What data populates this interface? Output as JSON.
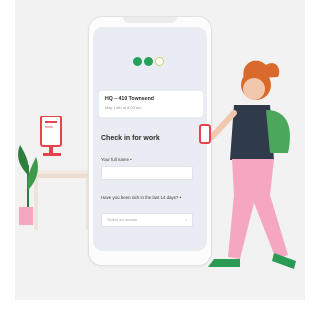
{
  "brand": {
    "accent_green": "#25a05a",
    "accent_lime": "#c9d46a",
    "ui_bg": "#e9edf3",
    "illustration_red": "#e8424c",
    "illustration_pink": "#f5a6c1"
  },
  "phone": {
    "progress": {
      "completed_steps": 2,
      "total_steps": 3
    },
    "location": {
      "title": "HQ – 410 Townsend",
      "subtitle": "May 14th at 8:00 am"
    },
    "form": {
      "title": "Check in for work",
      "full_name_label": "Your full name •",
      "full_name_value": "",
      "sick_question_label": "Have you been sick in the last 14 days? •",
      "sick_select_placeholder": "Select an answer",
      "sick_select_chevron": "⌄"
    }
  }
}
